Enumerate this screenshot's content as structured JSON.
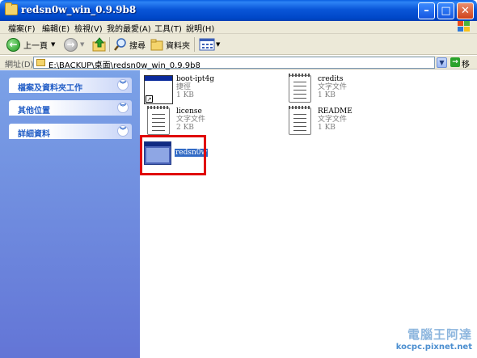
{
  "window": {
    "title": "redsn0w_win_0.9.9b8",
    "controls": [
      "minimize",
      "maximize",
      "close"
    ]
  },
  "menu": [
    "檔案(F)",
    "編輯(E)",
    "檢視(V)",
    "我的最愛(A)",
    "工具(T)",
    "說明(H)"
  ],
  "toolbar": {
    "back_label": "上一頁",
    "search_label": "搜尋",
    "folders_label": "資料夾"
  },
  "address": {
    "label": "網址(D)",
    "path": "E:\\BACKUP\\桌面\\redsn0w_win_0.9.9b8",
    "go_label": "移至"
  },
  "taskpane": {
    "groups": [
      {
        "label": "檔案及資料夾工作"
      },
      {
        "label": "其他位置"
      },
      {
        "label": "詳細資料"
      }
    ]
  },
  "files": [
    {
      "name": "boot-ipt4g",
      "type": "捷徑",
      "size": "1 KB",
      "icon": "shortcut-app-icon"
    },
    {
      "name": "credits",
      "type": "文字文件",
      "size": "1 KB",
      "icon": "text-document-icon"
    },
    {
      "name": "license",
      "type": "文字文件",
      "size": "2 KB",
      "icon": "text-document-icon"
    },
    {
      "name": "README",
      "type": "文字文件",
      "size": "1 KB",
      "icon": "text-document-icon"
    },
    {
      "name": "redsn0w",
      "icon": "application-icon",
      "selected": true,
      "highlighted": true
    }
  ],
  "watermark": {
    "line1": "電腦王阿達",
    "line2": "kocpc.pixnet.net"
  },
  "colors": {
    "titlebar": "#0a56d8",
    "taskpane": "#6f8ddf",
    "selection": "#316ac5",
    "highlight_box": "#e00000"
  }
}
